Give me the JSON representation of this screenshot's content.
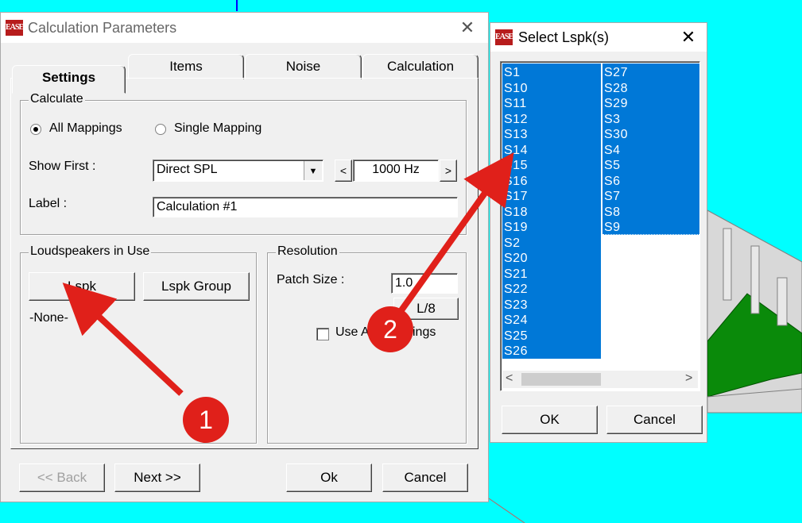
{
  "colors": {
    "background": "#00ffff",
    "selection": "#0078d7",
    "annotation": "#e0201a",
    "floor": "#0a8a0a"
  },
  "main_dialog": {
    "title": "Calculation Parameters",
    "app_icon_text": "EASE",
    "close_icon": "close-icon",
    "tabs": [
      {
        "label": "Settings",
        "active": true
      },
      {
        "label": "Items",
        "active": false
      },
      {
        "label": "Noise",
        "active": false
      },
      {
        "label": "Calculation",
        "active": false
      }
    ],
    "calculate": {
      "label": "Calculate",
      "all_mappings": "All Mappings",
      "single_mapping": "Single Mapping",
      "selected": "All Mappings",
      "show_first_label": "Show First :",
      "show_first_value": "Direct SPL",
      "frequency": "1000 Hz",
      "freq_prev": "<",
      "freq_next": ">",
      "label_label": "Label :",
      "label_value": "Calculation #1"
    },
    "loudspeakers": {
      "label": "Loudspeakers in Use",
      "lspk_button": "Lspk",
      "lspk_group_button": "Lspk Group",
      "status": "-None-"
    },
    "resolution": {
      "label": "Resolution",
      "patch_size_label": "Patch Size :",
      "patch_size_value": "1.0",
      "l8_button": "L/8",
      "use_checkbox_label_a": "Use A",
      "use_checkbox_label_b": "ings",
      "use_checkbox_checked": false
    },
    "buttons": {
      "back": "<< Back",
      "next": "Next >>",
      "ok": "Ok",
      "cancel": "Cancel"
    }
  },
  "select_dialog": {
    "title": "Select Lspk(s)",
    "app_icon_text": "EASE",
    "close_icon": "close-icon",
    "column1": [
      "S1",
      "S10",
      "S11",
      "S12",
      "S13",
      "S14",
      "S15",
      "S16",
      "S17",
      "S18",
      "S19",
      "S2",
      "S20",
      "S21",
      "S22",
      "S23",
      "S24",
      "S25",
      "S26"
    ],
    "column2": [
      "S27",
      "S28",
      "S29",
      "S3",
      "S30",
      "S4",
      "S5",
      "S6",
      "S7",
      "S8",
      "S9"
    ],
    "scroll_left": "<",
    "scroll_right": ">",
    "ok": "OK",
    "cancel": "Cancel"
  },
  "annotations": [
    {
      "number": "1",
      "target": "lspk-button"
    },
    {
      "number": "2",
      "target": "select-lspk-list"
    }
  ]
}
